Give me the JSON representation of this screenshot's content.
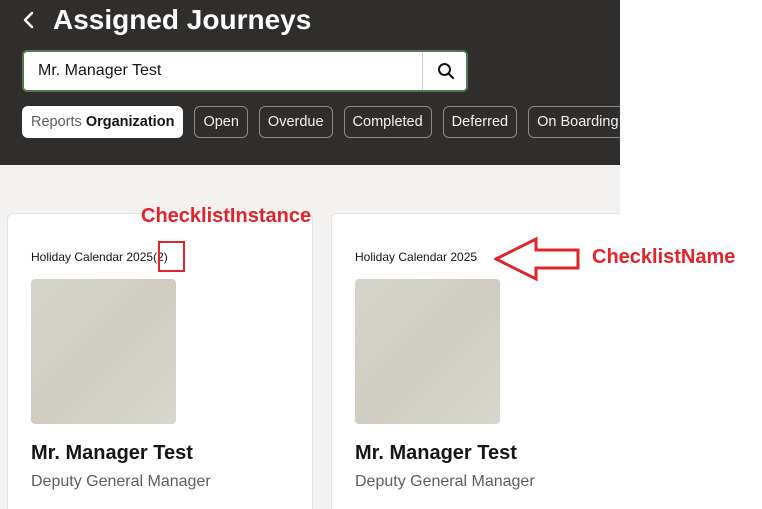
{
  "header": {
    "title": "Assigned Journeys",
    "search_value": "Mr. Manager Test"
  },
  "filters": {
    "chips": [
      {
        "prefix": "Reports",
        "label": "Organization",
        "active": true
      },
      {
        "label": "Open"
      },
      {
        "label": "Overdue"
      },
      {
        "label": "Completed"
      },
      {
        "label": "Deferred"
      },
      {
        "label": "On Boarding"
      }
    ]
  },
  "cards": [
    {
      "checklist": "Holiday Calendar 2025",
      "instance": "(2)",
      "person": "Mr. Manager Test",
      "role": "Deputy General Manager"
    },
    {
      "checklist": "Holiday Calendar 2025",
      "person": "Mr. Manager Test",
      "role": "Deputy General Manager"
    }
  ],
  "annotations": {
    "instance_label": "ChecklistInstance",
    "name_label": "ChecklistName",
    "color": "#e0242a"
  },
  "icons": {
    "back": "chevron-left-icon",
    "search": "search-icon"
  },
  "colors": {
    "header_bg": "#2f2e2d",
    "page_bg": "#f3f2f1",
    "search_border": "#4f7a4f"
  }
}
